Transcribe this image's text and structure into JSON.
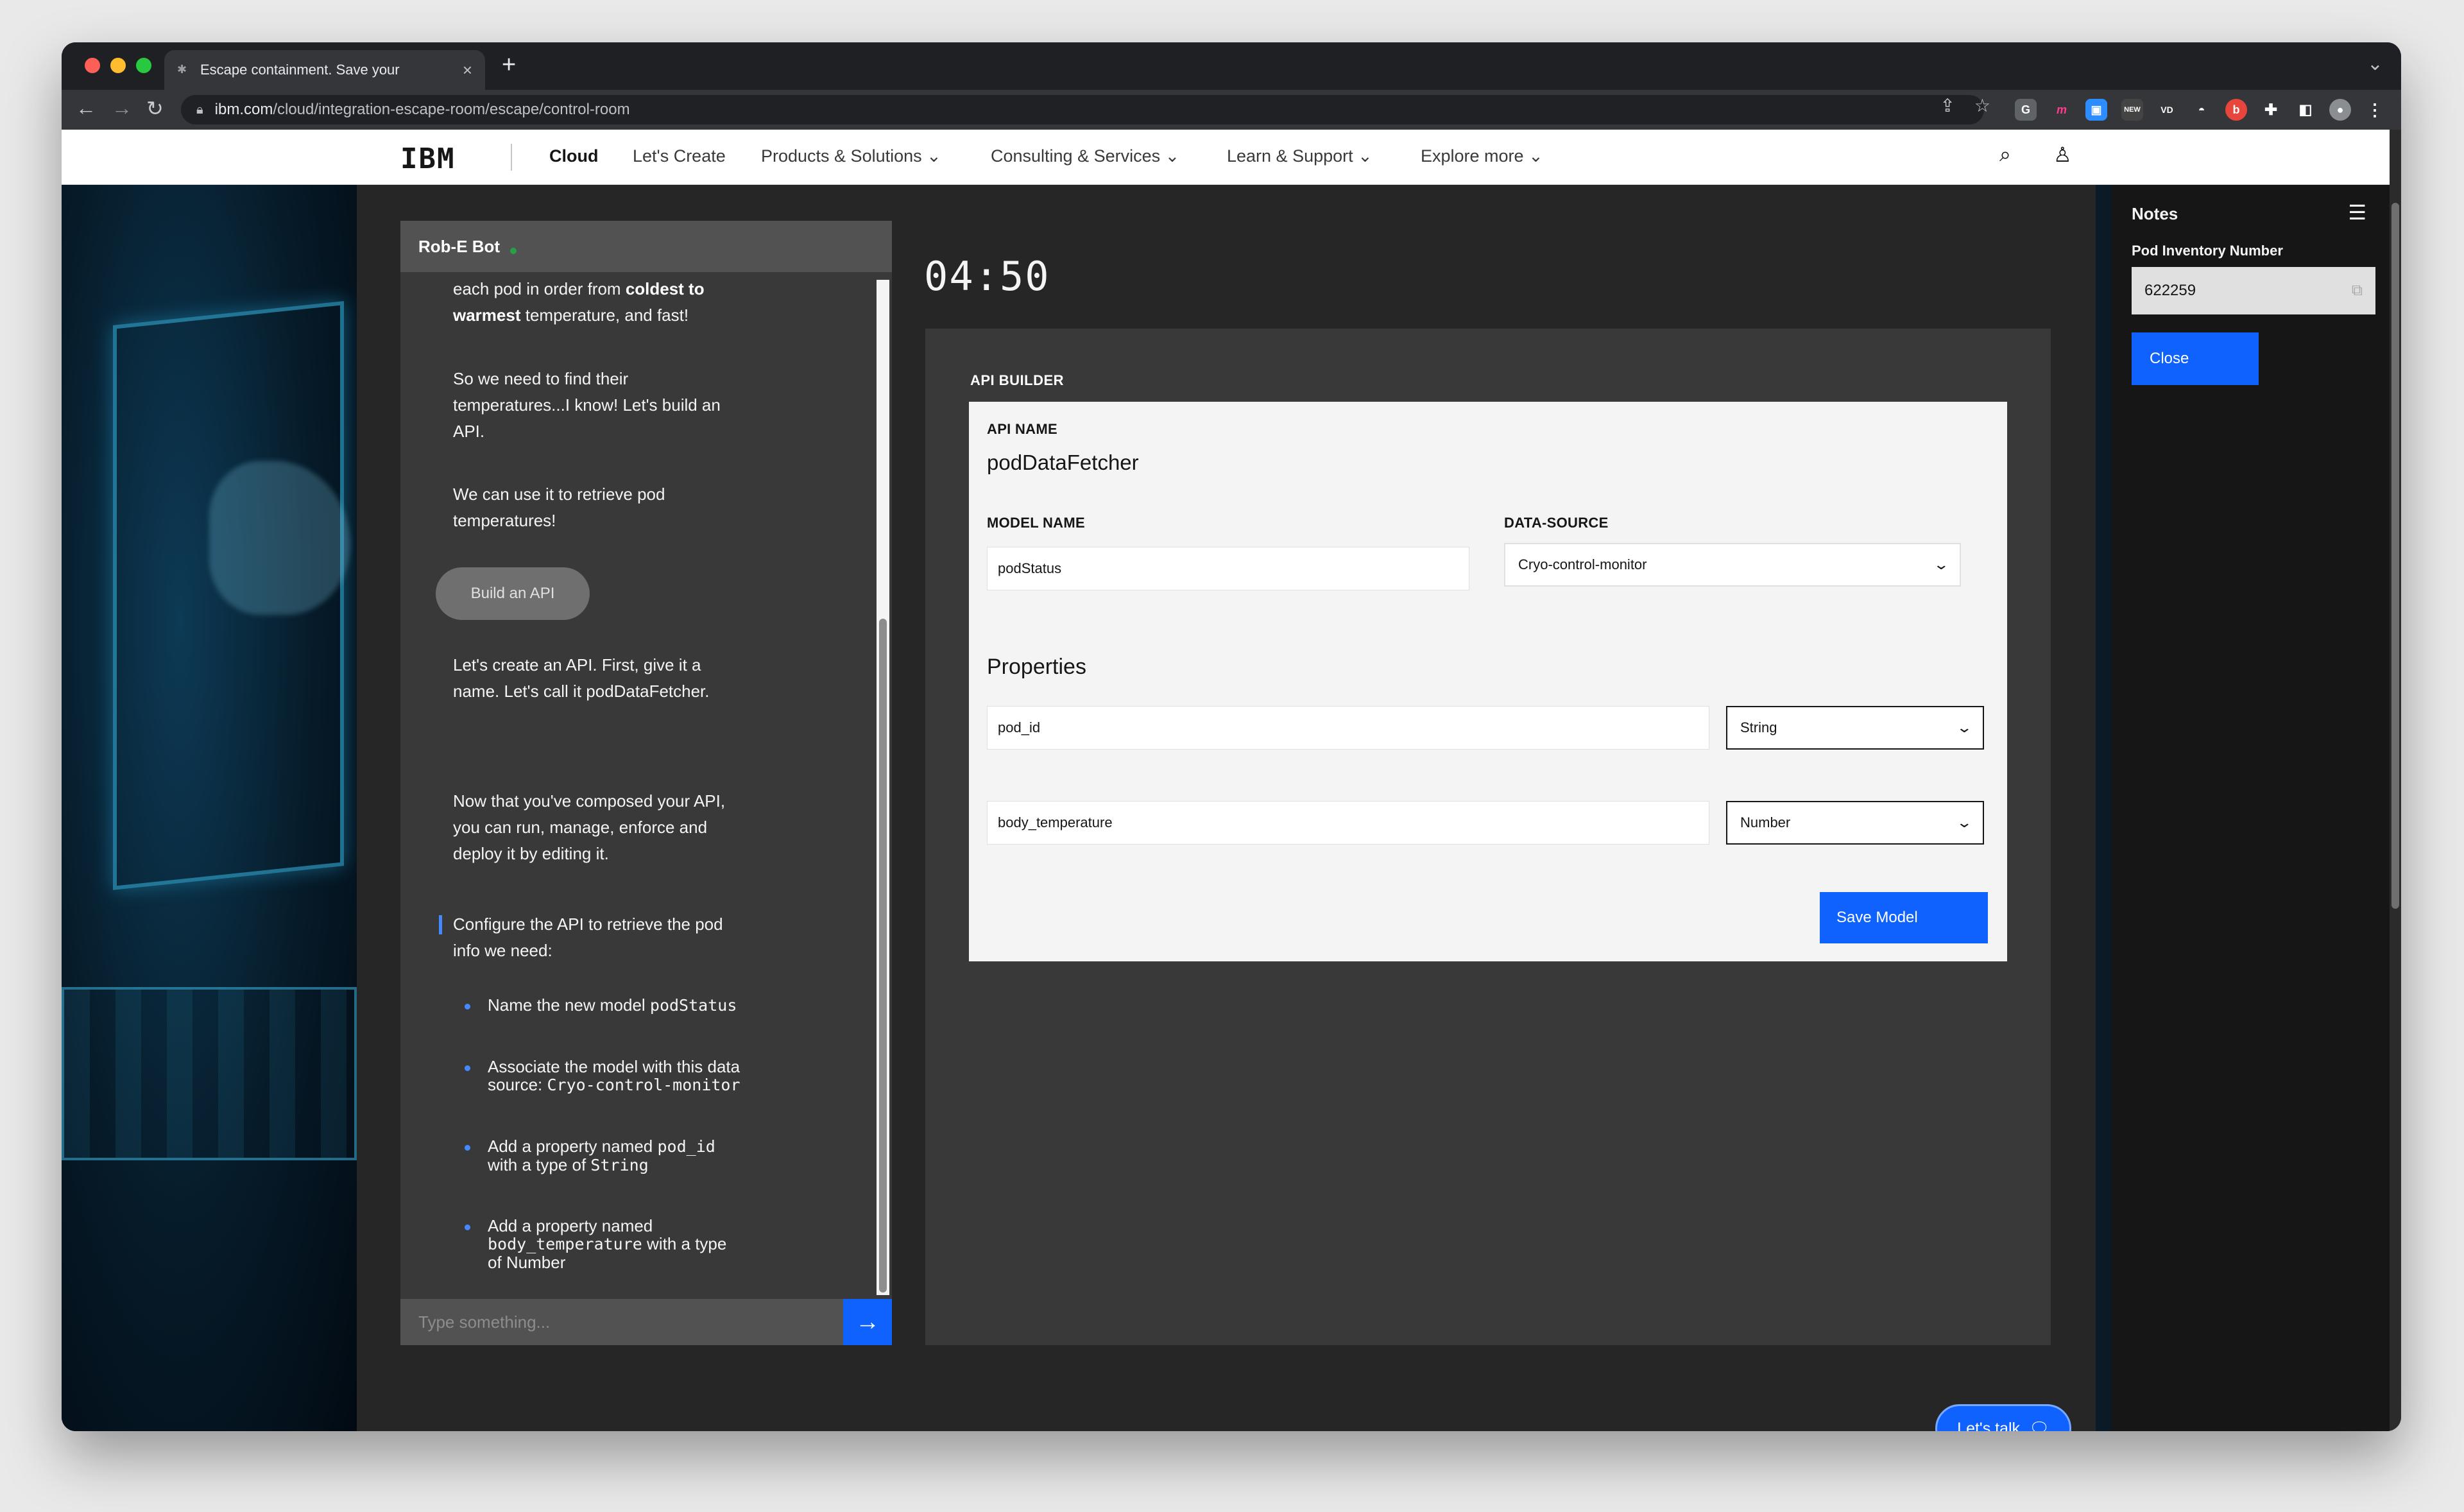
{
  "browser": {
    "tab_title": "Escape containment. Save your",
    "url_domain": "ibm.com",
    "url_path": "/cloud/integration-escape-room/escape/control-room",
    "new_tab_symbol": "+",
    "tab_close_symbol": "×"
  },
  "nav": {
    "logo": "IBM",
    "items": [
      {
        "label": "Cloud"
      },
      {
        "label": "Let's Create"
      },
      {
        "label": "Products & Solutions"
      },
      {
        "label": "Consulting & Services"
      },
      {
        "label": "Learn & Support"
      },
      {
        "label": "Explore more"
      }
    ]
  },
  "chat": {
    "bot_name": "Rob-E Bot",
    "messages": [
      {
        "pre": "each pod in order from ",
        "bold1": "coldest to warmest",
        "post": " temperature, and fast!"
      },
      {
        "text": "So we need to find their temperatures...I know! Let's build an API."
      },
      {
        "text": "We can use it to retrieve pod temperatures!"
      },
      {
        "text": "Let's create an API. First, give it a name. Let's call it podDataFetcher."
      },
      {
        "text": "Now that you've composed your API, you can run, manage, enforce and deploy it by editing it."
      },
      {
        "text": "Configure the API to retrieve the pod info we need:"
      }
    ],
    "quick_reply": "Build an API",
    "bullets": [
      {
        "text": "Name the new model ",
        "code": "podStatus",
        "tail": ""
      },
      {
        "text": "Associate the model with this data source: ",
        "code": "Cryo-control-monitor",
        "tail": ""
      },
      {
        "text": "Add a property named ",
        "code": "pod_id",
        "tail": " with a type of ",
        "code2": "String"
      },
      {
        "text": "Add a property named ",
        "code": "body_temperature",
        "tail": " with a type of Number"
      }
    ],
    "input_placeholder": "Type something..."
  },
  "timer": "04:50",
  "builder": {
    "section_label": "API BUILDER",
    "api_name_label": "API NAME",
    "api_name": "podDataFetcher",
    "model_name_label": "MODEL NAME",
    "model_name": "podStatus",
    "data_source_label": "DATA-SOURCE",
    "data_source": "Cryo-control-monitor",
    "properties_title": "Properties",
    "properties": [
      {
        "name": "pod_id",
        "type": "String"
      },
      {
        "name": "body_temperature",
        "type": "Number"
      }
    ],
    "save_label": "Save Model"
  },
  "lets_talk": "Let's talk",
  "notes": {
    "title": "Notes",
    "pod_label": "Pod Inventory Number",
    "pod_value": "622259",
    "close_label": "Close"
  },
  "colors": {
    "accent_blue": "#0f62fe",
    "bot_online": "#24a148",
    "bullet_blue": "#4589ff"
  }
}
